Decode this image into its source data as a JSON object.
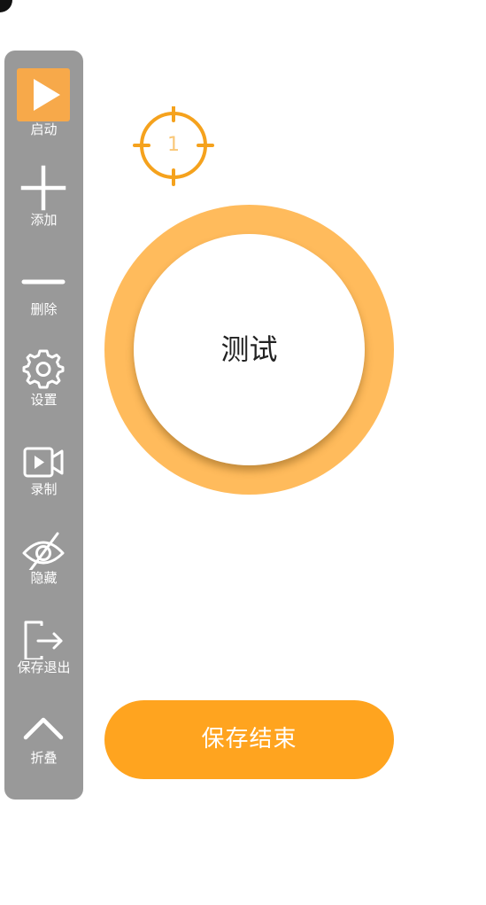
{
  "toolbar": {
    "items": [
      {
        "label": "启动",
        "icon": "play-icon"
      },
      {
        "label": "添加",
        "icon": "plus-icon"
      },
      {
        "label": "删除",
        "icon": "minus-icon"
      },
      {
        "label": "设置",
        "icon": "gear-icon"
      },
      {
        "label": "录制",
        "icon": "video-camera-icon"
      },
      {
        "label": "隐藏",
        "icon": "eye-off-icon"
      },
      {
        "label": "保存退出",
        "icon": "exit-icon"
      },
      {
        "label": "折叠",
        "icon": "chevron-up-icon"
      }
    ]
  },
  "target": {
    "number": "1",
    "icon": "crosshair-icon"
  },
  "test_button": {
    "label": "测试"
  },
  "save_button": {
    "label": "保存结束"
  },
  "colors": {
    "accent": "#ffa41f",
    "ring": "#ffbb5c",
    "toolbar_bg": "#999999",
    "play_tile": "#f7a94a",
    "marker": "#f5a21d"
  }
}
